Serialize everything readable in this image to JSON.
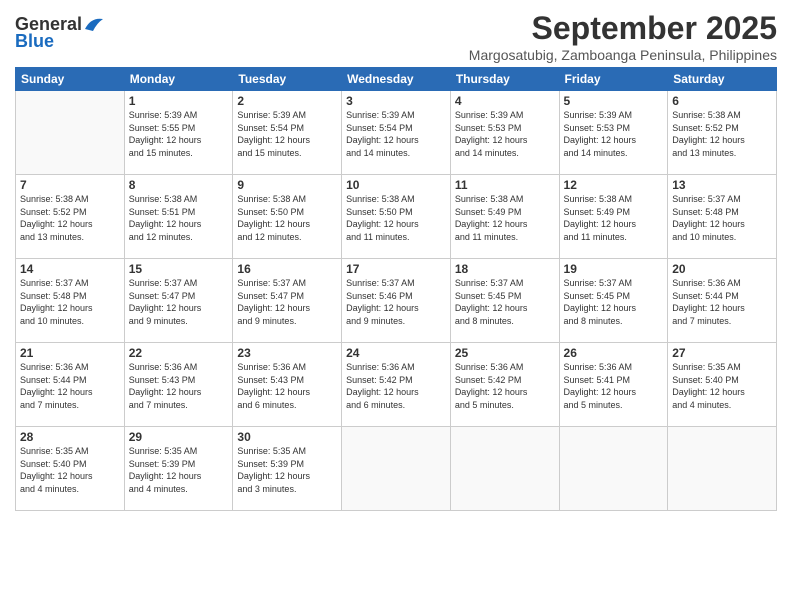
{
  "logo": {
    "general": "General",
    "blue": "Blue"
  },
  "header": {
    "month": "September 2025",
    "location": "Margosatubig, Zamboanga Peninsula, Philippines"
  },
  "days_of_week": [
    "Sunday",
    "Monday",
    "Tuesday",
    "Wednesday",
    "Thursday",
    "Friday",
    "Saturday"
  ],
  "weeks": [
    [
      {
        "day": "",
        "info": ""
      },
      {
        "day": "1",
        "info": "Sunrise: 5:39 AM\nSunset: 5:55 PM\nDaylight: 12 hours\nand 15 minutes."
      },
      {
        "day": "2",
        "info": "Sunrise: 5:39 AM\nSunset: 5:54 PM\nDaylight: 12 hours\nand 15 minutes."
      },
      {
        "day": "3",
        "info": "Sunrise: 5:39 AM\nSunset: 5:54 PM\nDaylight: 12 hours\nand 14 minutes."
      },
      {
        "day": "4",
        "info": "Sunrise: 5:39 AM\nSunset: 5:53 PM\nDaylight: 12 hours\nand 14 minutes."
      },
      {
        "day": "5",
        "info": "Sunrise: 5:39 AM\nSunset: 5:53 PM\nDaylight: 12 hours\nand 14 minutes."
      },
      {
        "day": "6",
        "info": "Sunrise: 5:38 AM\nSunset: 5:52 PM\nDaylight: 12 hours\nand 13 minutes."
      }
    ],
    [
      {
        "day": "7",
        "info": "Sunrise: 5:38 AM\nSunset: 5:52 PM\nDaylight: 12 hours\nand 13 minutes."
      },
      {
        "day": "8",
        "info": "Sunrise: 5:38 AM\nSunset: 5:51 PM\nDaylight: 12 hours\nand 12 minutes."
      },
      {
        "day": "9",
        "info": "Sunrise: 5:38 AM\nSunset: 5:50 PM\nDaylight: 12 hours\nand 12 minutes."
      },
      {
        "day": "10",
        "info": "Sunrise: 5:38 AM\nSunset: 5:50 PM\nDaylight: 12 hours\nand 11 minutes."
      },
      {
        "day": "11",
        "info": "Sunrise: 5:38 AM\nSunset: 5:49 PM\nDaylight: 12 hours\nand 11 minutes."
      },
      {
        "day": "12",
        "info": "Sunrise: 5:38 AM\nSunset: 5:49 PM\nDaylight: 12 hours\nand 11 minutes."
      },
      {
        "day": "13",
        "info": "Sunrise: 5:37 AM\nSunset: 5:48 PM\nDaylight: 12 hours\nand 10 minutes."
      }
    ],
    [
      {
        "day": "14",
        "info": "Sunrise: 5:37 AM\nSunset: 5:48 PM\nDaylight: 12 hours\nand 10 minutes."
      },
      {
        "day": "15",
        "info": "Sunrise: 5:37 AM\nSunset: 5:47 PM\nDaylight: 12 hours\nand 9 minutes."
      },
      {
        "day": "16",
        "info": "Sunrise: 5:37 AM\nSunset: 5:47 PM\nDaylight: 12 hours\nand 9 minutes."
      },
      {
        "day": "17",
        "info": "Sunrise: 5:37 AM\nSunset: 5:46 PM\nDaylight: 12 hours\nand 9 minutes."
      },
      {
        "day": "18",
        "info": "Sunrise: 5:37 AM\nSunset: 5:45 PM\nDaylight: 12 hours\nand 8 minutes."
      },
      {
        "day": "19",
        "info": "Sunrise: 5:37 AM\nSunset: 5:45 PM\nDaylight: 12 hours\nand 8 minutes."
      },
      {
        "day": "20",
        "info": "Sunrise: 5:36 AM\nSunset: 5:44 PM\nDaylight: 12 hours\nand 7 minutes."
      }
    ],
    [
      {
        "day": "21",
        "info": "Sunrise: 5:36 AM\nSunset: 5:44 PM\nDaylight: 12 hours\nand 7 minutes."
      },
      {
        "day": "22",
        "info": "Sunrise: 5:36 AM\nSunset: 5:43 PM\nDaylight: 12 hours\nand 7 minutes."
      },
      {
        "day": "23",
        "info": "Sunrise: 5:36 AM\nSunset: 5:43 PM\nDaylight: 12 hours\nand 6 minutes."
      },
      {
        "day": "24",
        "info": "Sunrise: 5:36 AM\nSunset: 5:42 PM\nDaylight: 12 hours\nand 6 minutes."
      },
      {
        "day": "25",
        "info": "Sunrise: 5:36 AM\nSunset: 5:42 PM\nDaylight: 12 hours\nand 5 minutes."
      },
      {
        "day": "26",
        "info": "Sunrise: 5:36 AM\nSunset: 5:41 PM\nDaylight: 12 hours\nand 5 minutes."
      },
      {
        "day": "27",
        "info": "Sunrise: 5:35 AM\nSunset: 5:40 PM\nDaylight: 12 hours\nand 4 minutes."
      }
    ],
    [
      {
        "day": "28",
        "info": "Sunrise: 5:35 AM\nSunset: 5:40 PM\nDaylight: 12 hours\nand 4 minutes."
      },
      {
        "day": "29",
        "info": "Sunrise: 5:35 AM\nSunset: 5:39 PM\nDaylight: 12 hours\nand 4 minutes."
      },
      {
        "day": "30",
        "info": "Sunrise: 5:35 AM\nSunset: 5:39 PM\nDaylight: 12 hours\nand 3 minutes."
      },
      {
        "day": "",
        "info": ""
      },
      {
        "day": "",
        "info": ""
      },
      {
        "day": "",
        "info": ""
      },
      {
        "day": "",
        "info": ""
      }
    ]
  ]
}
